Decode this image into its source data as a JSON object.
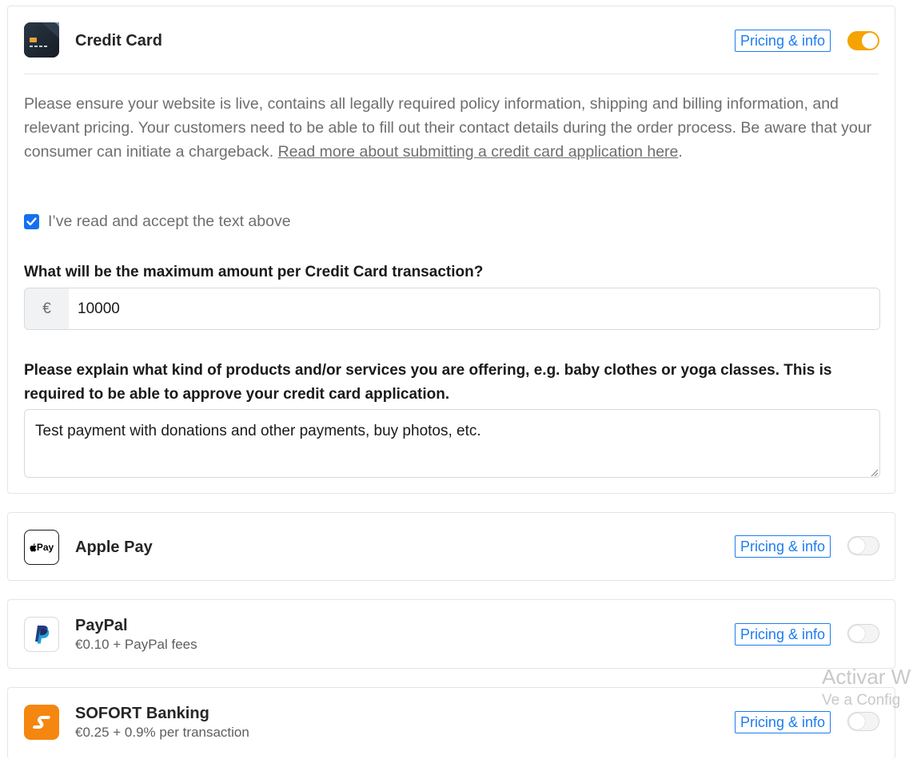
{
  "credit_card": {
    "title": "Credit Card",
    "pricing_label": "Pricing & info",
    "enabled": true,
    "notice_text": "Please ensure your website is live, contains all legally required policy information, shipping and billing information, and relevant pricing. Your customers need to be able to fill out their contact details during the order process. Be aware that your consumer can initiate a chargeback. ",
    "notice_link": "Read more about submitting a credit card application here",
    "notice_end": ".",
    "accept_label": "I’ve read and accept the text above",
    "accept_checked": true,
    "max_amount_question": "What will be the maximum amount per Credit Card transaction?",
    "currency_symbol": "€",
    "max_amount_value": "10000",
    "products_question": "Please explain what kind of products and/or services you are offering, e.g. baby clothes or yoga classes. This is required to be able to approve your credit card application.",
    "products_value": "Test payment with donations and other payments, buy photos, etc."
  },
  "apple_pay": {
    "title": "Apple Pay",
    "icon_text": "Pay",
    "pricing_label": "Pricing & info",
    "enabled": false
  },
  "paypal": {
    "title": "PayPal",
    "subtitle": "€0.10 + PayPal fees",
    "pricing_label": "Pricing & info",
    "enabled": false
  },
  "sofort": {
    "title": "SOFORT Banking",
    "subtitle": "€0.25 + 0.9% per transaction",
    "pricing_label": "Pricing & info",
    "enabled": false
  },
  "watermark": {
    "line1": "Activar W",
    "line2": "Ve a Config"
  },
  "colors": {
    "accent_toggle": "#f5a300",
    "link_blue": "#1e7df0",
    "checkbox_blue": "#1570ef",
    "sofort_orange": "#f5860f",
    "paypal_dark": "#253b80",
    "paypal_light": "#179bd7"
  }
}
